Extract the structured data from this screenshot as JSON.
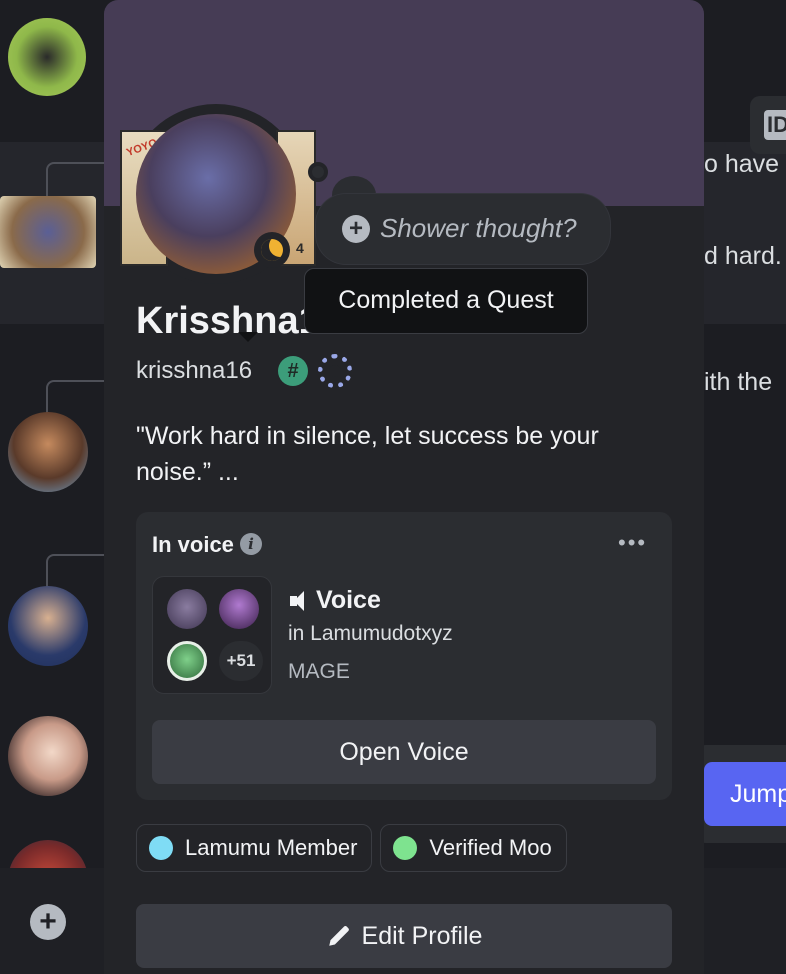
{
  "background": {
    "chat_snippets": [
      "o have",
      "d hard.",
      "ith the"
    ],
    "id_badge": "ID",
    "jump_label": "Jump"
  },
  "profile": {
    "display_name": "Krisshna16",
    "username": "krisshna16",
    "thought_placeholder": "Shower thought?",
    "tooltip": "Completed a Quest",
    "bio": "\"Work hard in silence, let success be your noise.” ...",
    "avatar_deco_number": "4"
  },
  "voice": {
    "header": "In voice",
    "title": "Voice",
    "server": "in Lamumudotxyz",
    "channel_note": "MAGE",
    "extra_count": "+51",
    "open_button": "Open Voice"
  },
  "roles": [
    {
      "name": "Lamumu Member",
      "color": "#7fdcf5"
    },
    {
      "name": "Verified Moo",
      "color": "#7ee38f"
    }
  ],
  "actions": {
    "edit_profile": "Edit Profile"
  },
  "colors": {
    "banner": "#463c55",
    "card": "#232428",
    "accent": "#5865f2"
  }
}
